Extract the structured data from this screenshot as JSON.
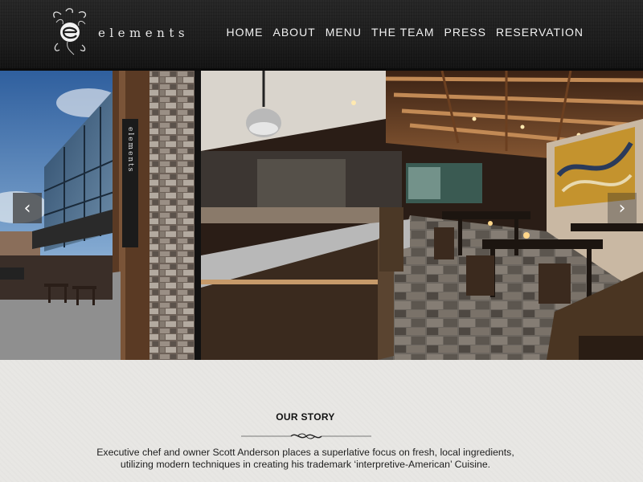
{
  "brand": {
    "logo_text": "elements",
    "logo_icon": "stylized-e-logo-icon"
  },
  "nav": {
    "items": [
      {
        "label": "HOME"
      },
      {
        "label": "ABOUT"
      },
      {
        "label": "MENU"
      },
      {
        "label": "THE TEAM"
      },
      {
        "label": "PRESS"
      },
      {
        "label": "RESERVATION"
      }
    ]
  },
  "slider": {
    "prev_icon": "chevron-left-icon",
    "next_icon": "chevron-right-icon",
    "prev_glyph": "‹",
    "next_glyph": "›",
    "building_sign_text": "elements"
  },
  "story": {
    "title": "OUR STORY",
    "divider_icon": "ornamental-divider-icon",
    "text": "Executive chef and owner Scott Anderson places a superlative focus on fresh, local ingredients, utilizing modern techniques in creating his trademark ‘interpretive-American’ Cuisine."
  },
  "colors": {
    "header_bg": "#1f1f1f",
    "nav_text": "#f2f2f2",
    "page_bg": "#e8e7e4",
    "body_text": "#1e1e1e"
  }
}
